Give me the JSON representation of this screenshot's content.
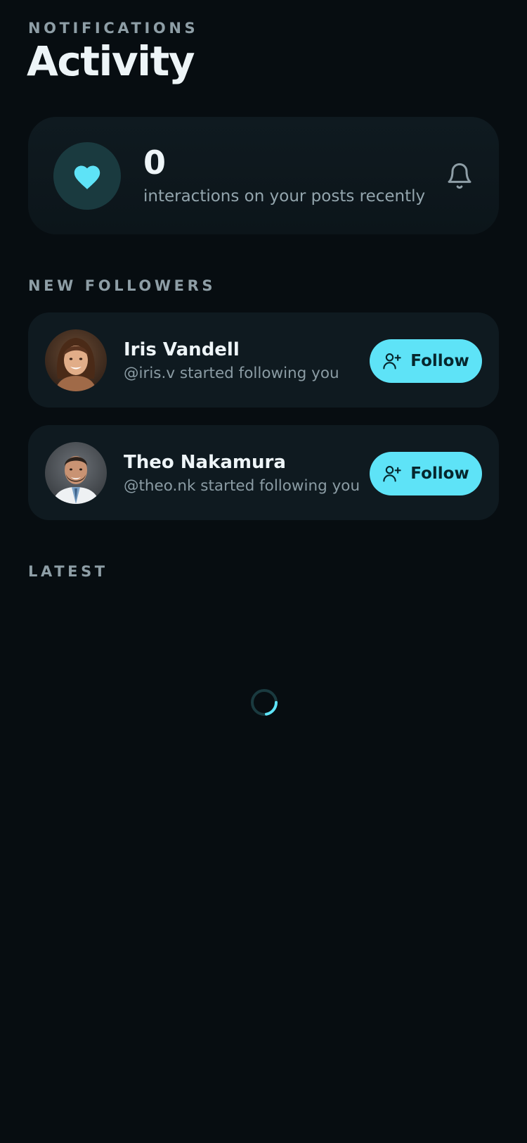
{
  "header": {
    "eyebrow": "NOTIFICATIONS",
    "title": "Activity"
  },
  "summary": {
    "count": "0",
    "text": "interactions on your posts recently",
    "icon": "heart-icon",
    "action_icon": "bell-icon"
  },
  "sections": {
    "new_followers": "NEW FOLLOWERS",
    "latest": "LATEST"
  },
  "followers": [
    {
      "name": "Iris Vandell",
      "subtitle": "@iris.v started following you",
      "button_label": "Follow",
      "avatar": "woman-avatar"
    },
    {
      "name": "Theo Nakamura",
      "subtitle": "@theo.nk started following you",
      "button_label": "Follow",
      "avatar": "man-avatar"
    }
  ],
  "latest": {
    "state": "loading",
    "icon": "spinner-icon"
  },
  "colors": {
    "background": "#070d11",
    "card": "#0f1a20",
    "accent": "#5ee3f7",
    "muted_text": "#8e9ea6"
  }
}
